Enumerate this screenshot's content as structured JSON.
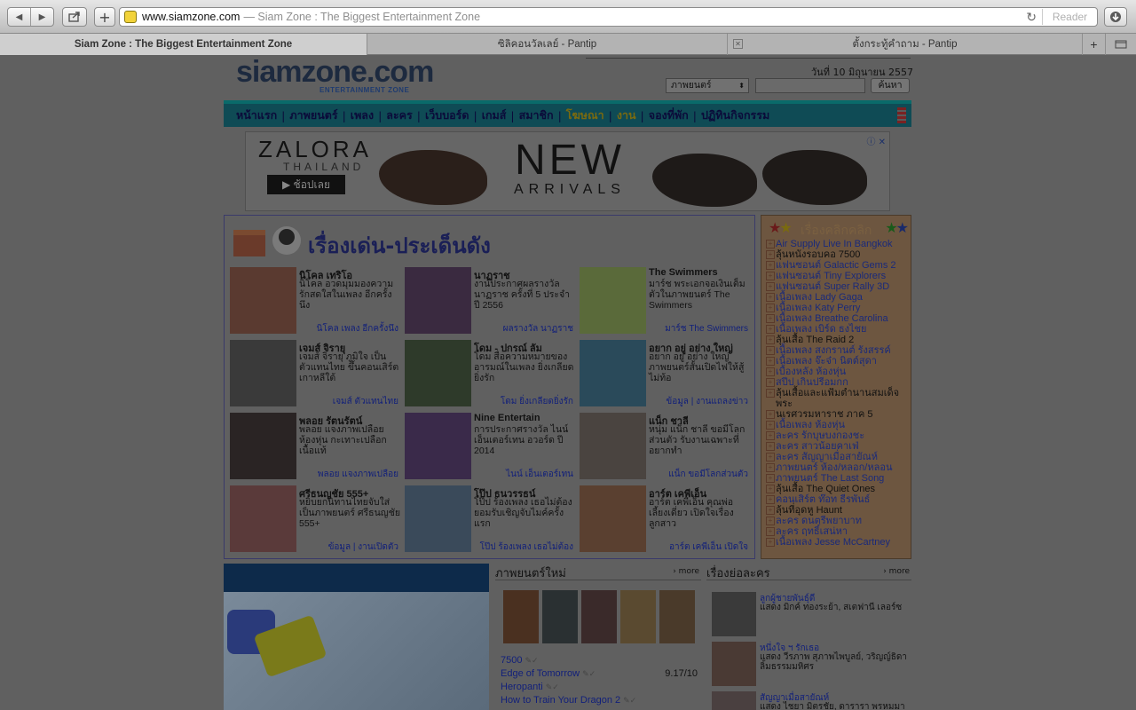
{
  "browser": {
    "url": "www.siamzone.com",
    "url_title": "— Siam Zone : The Biggest Entertainment Zone",
    "reader_label": "Reader",
    "tabs": [
      {
        "label": "Siam Zone : The Biggest Entertainment Zone",
        "active": true
      },
      {
        "label": "ซิลิคอนวัลเลย์ - Pantip",
        "active": false
      },
      {
        "label": "ตั้งกระทู้คำถาม - Pantip",
        "active": false
      }
    ]
  },
  "site": {
    "logo_main": "siamzone.com",
    "logo_sub": "ENTERTAINMENT ZONE",
    "date": "วันที่ 10 มิถุนายน 2557",
    "search_select": "ภาพยนตร์",
    "search_button": "ค้นหา",
    "nav": [
      "หน้าแรก",
      "ภาพยนตร์",
      "เพลง",
      "ละคร",
      "เว็บบอร์ด",
      "เกมส์",
      "สมาชิก",
      "โฆษณา",
      "งาน",
      "จองที่พัก",
      "ปฏิทินกิจกรรม"
    ]
  },
  "banner": {
    "brand": "ZALORA",
    "brand_sub": "THAILAND",
    "shop_label": "▶ ช้อปเลย",
    "headline": "NEW",
    "headline_sub": "ARRIVALS"
  },
  "featured": {
    "title": "เรื่องเด่น-ประเด็นดัง",
    "items": [
      {
        "title": "นิโคล เทริโอ",
        "desc": "นิโคล อวดมุมมองความรักสดใสในเพลง อีกครั้งนึง",
        "link": "นิโคล เพลง อีกครั้งนึง"
      },
      {
        "title": "นาฏราช",
        "desc": "งานประกาศผลรางวัล นาฏราช ครั้งที่ 5 ประจำปี 2556",
        "link": "ผลรางวัล นาฏราช"
      },
      {
        "title": "The Swimmers",
        "desc": "มาร์ช พระเอกจอเงินเต็มตัวในภาพยนตร์ The Swimmers",
        "link": "มาร์ช The Swimmers"
      },
      {
        "title": "เจมส์ จิรายุ",
        "desc": "เจมส์ จิรายุ ภูมิใจ เป็นตัวแทนไทย ขึ้นคอนเสิร์ตเกาหลีใต้",
        "link": "เจมส์ ตัวแทนไทย"
      },
      {
        "title": "โดม - ปกรณ์ ลัม",
        "desc": "โดม สื่อความหมายของอารมณ์ในเพลง ยิ่งเกลียดยิ่งรัก",
        "link": "โดม ยิ่งเกลียดยิ่งรัก"
      },
      {
        "title": "อยาก อยู่ อย่าง ใหญ่",
        "desc": "อยาก อยู่ อย่าง ใหญ่ ภาพยนตร์สั้นเปิดไฟให้สู้ไม่ท้อ",
        "link": "ข้อมูล | งานแถลงข่าว"
      },
      {
        "title": "พลอย รัตนรัตน์",
        "desc": "พลอย แจงภาพเปลือย ห้องหุ่น กะเทาะเปลือกเนื้อแท้",
        "link": "พลอย แจงภาพเปลือย"
      },
      {
        "title": "Nine Entertain",
        "desc": "การประกาศรางวัล ไนน์ เอ็นเตอร์เทน อวอร์ด ปี 2014",
        "link": "ไนน์ เอ็นเตอร์เทน"
      },
      {
        "title": "แน็ก ชาลี",
        "desc": "หนุ่ม แน็ก ชาลี ขอมีโลกส่วนตัว รับงานเฉพาะที่อยากทำ",
        "link": "แน็ก ขอมีโลกส่วนตัว"
      },
      {
        "title": "ศรีธนญชัย 555+",
        "desc": "หยิบยกนิทานไทยจับใส่เป็นภาพยนตร์ ศรีธนญชัย 555+",
        "link": "ข้อมูล | งานเปิดตัว"
      },
      {
        "title": "โป๊ป ธนวรรธน์",
        "desc": "โป๊ป ร้องเพลง เธอไม่ต้องยอมรับเชิญจับไมค์ครั้งแรก",
        "link": "โป๊ป ร้องเพลง เธอไม่ต้อง"
      },
      {
        "title": "อาร์ต เคพีเอ็น",
        "desc": "อาร์ต เคพีเอ็น คุณพ่อเลี้ยงเดี่ยว เปิดใจเรื่องลูกสาว",
        "link": "อาร์ต เคพีเอ็น เปิดใจ"
      }
    ]
  },
  "classic": {
    "title": "เรื่องคลิกคลิก",
    "items": [
      {
        "text": "Air Supply Live In Bangkok",
        "dark": false
      },
      {
        "text": "ลุ้นหนังรอบคอ 7500",
        "dark": true
      },
      {
        "text": "แฟนซอนต์ Galactic Gems 2",
        "dark": false
      },
      {
        "text": "แฟนซอนต์ Tiny Explorers",
        "dark": false
      },
      {
        "text": "แฟนซอนต์ Super Rally 3D",
        "dark": false
      },
      {
        "text": "เนื้อเพลง Lady Gaga",
        "dark": false
      },
      {
        "text": "เนื้อเพลง Katy Perry",
        "dark": false
      },
      {
        "text": "เนื้อเพลง Breathe Carolina",
        "dark": false
      },
      {
        "text": "เนื้อเพลง เบิร์ด ธงไชย",
        "dark": false
      },
      {
        "text": "ลุ้นเสื้อ The Raid 2",
        "dark": true
      },
      {
        "text": "เนื้อเพลง สงกรานต์ รังสรรค์",
        "dark": false
      },
      {
        "text": "เนื้อเพลง จ๊ะจ๋า นิตต์สุดา",
        "dark": false
      },
      {
        "text": "เบื้องหลัง ห้องหุ่น",
        "dark": false
      },
      {
        "text": "สปีป เกินปรีอมกก",
        "dark": false
      },
      {
        "text": "ลุ้นเสื้อและแฟ้มตำนานสมเด็จพระ",
        "dark": true
      },
      {
        "text": "นเรศวรมหาราช ภาค 5",
        "dark": true
      },
      {
        "text": "เนื้อเพลง ห้องหุ่น",
        "dark": false
      },
      {
        "text": "ละคร รักบุษบงกองชะ",
        "dark": false
      },
      {
        "text": "ละคร สาวน้อยคาเฟ่",
        "dark": false
      },
      {
        "text": "ละคร สัญญาเมื่อสายัณห์",
        "dark": false
      },
      {
        "text": "ภาพยนตร์ ห้อง/หลอก/หลอน",
        "dark": false
      },
      {
        "text": "ภาพยนตร์ The Last Song",
        "dark": false
      },
      {
        "text": "ลุ้นเสื้อ The Quiet Ones",
        "dark": true
      },
      {
        "text": "คอนเสิร์ต ท๊อท ธีรพันธ์",
        "dark": false
      },
      {
        "text": "ลุ้นที่อุดหู Haunt",
        "dark": true
      },
      {
        "text": "ละคร ดนตรีพยาบาท",
        "dark": false
      },
      {
        "text": "ละคร ฤทธิ์เสน่หา",
        "dark": false
      },
      {
        "text": "เนื้อเพลง Jesse McCartney",
        "dark": false
      }
    ]
  },
  "movies": {
    "title": "ภาพยนตร์ใหม่",
    "more": "more",
    "list": [
      {
        "name": "7500",
        "score": ""
      },
      {
        "name": "Edge of Tomorrow",
        "score": "9.17/10"
      },
      {
        "name": "Heropanti",
        "score": ""
      },
      {
        "name": "How to Train Your Dragon 2",
        "score": ""
      }
    ]
  },
  "series": {
    "title": "เรื่องย่อละคร",
    "more": "more",
    "items": [
      {
        "title": "ลูกผู้ชายพันธุ์ดี",
        "desc": "แสดง มิกค์ ทองระย้า, สเตฟานี เลอร์ซ"
      },
      {
        "title": "หนึ่งใจ ฯ รักเธอ",
        "desc": "แสดง วีรภาพ สุภาพไพบูลย์, วริญญ์ธิดา ลิ้มธรรมมหิศร"
      },
      {
        "title": "สัญญาเมื่อสายัณห์",
        "desc": "แสดง ไชยา มิตรชัย, ดารารา พรหมมา"
      }
    ]
  },
  "colors": {
    "nav_bg": "#0f4b55",
    "link": "#12207a",
    "classic_bg": "#6d5640"
  }
}
